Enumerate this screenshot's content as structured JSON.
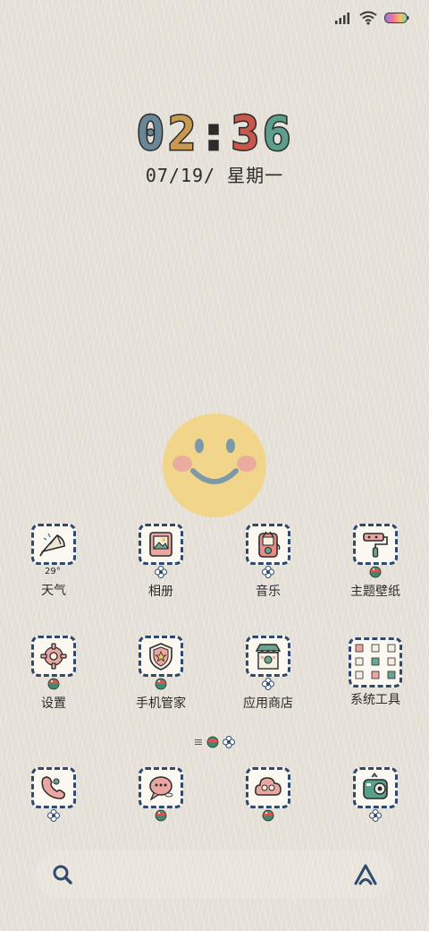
{
  "status_bar": {
    "icons": [
      "signal-icon",
      "wifi-icon",
      "battery-icon"
    ],
    "battery_colors": [
      "#8f7cf0",
      "#f2709c",
      "#f4c15c",
      "#6fd3c8"
    ]
  },
  "clock": {
    "digits": [
      "0",
      "2",
      ":",
      "3",
      "6"
    ],
    "digit_colors": [
      "#6b8797",
      "#c89a51",
      "#2b2b2b",
      "#c9574d",
      "#5a9f8b"
    ],
    "date": "07/19/ 星期一"
  },
  "apps": {
    "row1": [
      {
        "label": "天气",
        "icon": "umbrella-icon",
        "badge": "",
        "extra": "29°"
      },
      {
        "label": "相册",
        "icon": "photo-icon",
        "badge": "flower-badge"
      },
      {
        "label": "音乐",
        "icon": "music-player-icon",
        "badge": "flower-badge"
      },
      {
        "label": "主题壁纸",
        "icon": "paint-roller-icon",
        "badge": "ball-badge"
      }
    ],
    "row2": [
      {
        "label": "设置",
        "icon": "gear-icon",
        "badge": "ball-badge"
      },
      {
        "label": "手机管家",
        "icon": "shield-icon",
        "badge": "ball-badge"
      },
      {
        "label": "应用商店",
        "icon": "store-icon",
        "badge": "flower-badge"
      },
      {
        "label": "系统工具",
        "icon": "tools-folder-icon",
        "badge": ""
      }
    ],
    "dock": [
      {
        "label": "",
        "icon": "phone-icon",
        "badge": "flower-badge"
      },
      {
        "label": "",
        "icon": "message-icon",
        "badge": "ball-badge"
      },
      {
        "label": "",
        "icon": "cloud-icon",
        "badge": "ball-badge"
      },
      {
        "label": "",
        "icon": "camera-icon",
        "badge": "flower-badge"
      }
    ]
  },
  "colors": {
    "frame": "#2f4a6d",
    "text": "#2b2b2b",
    "background": "#e7e2d9",
    "smiley": "#f2d27c"
  }
}
